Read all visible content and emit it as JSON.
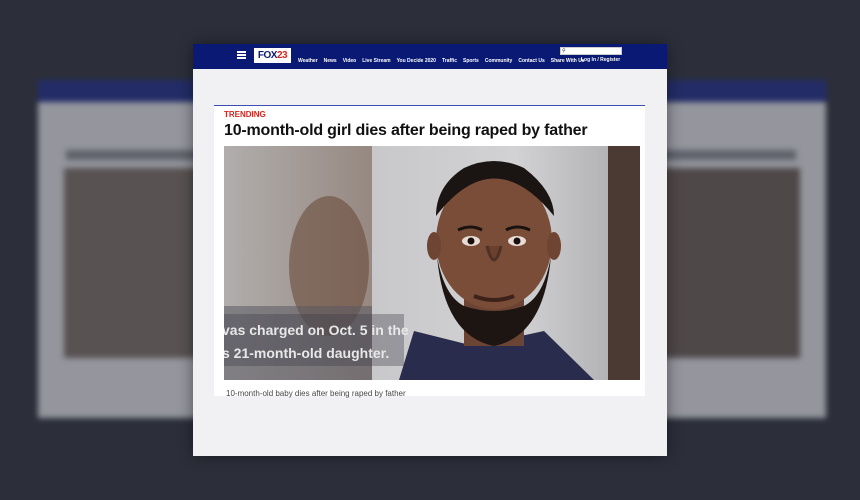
{
  "site": {
    "logo_text": "FOX",
    "logo_number": "23",
    "nav_items": [
      "Weather",
      "News",
      "Video",
      "Live Stream",
      "You Decide 2020",
      "Traffic",
      "Sports",
      "Community",
      "Contact Us",
      "Share With Us"
    ],
    "login_label": "Log In / Register"
  },
  "article": {
    "category": "TRENDING",
    "headline": "10-month-old girl dies after being raped by father",
    "video_overlay_line1": "vas charged on Oct. 5 in the",
    "video_overlay_line2": "s 21-month-old daughter.",
    "caption": "10-month-old baby dies after being raped by father"
  },
  "colors": {
    "nav_bg": "#0a1a74",
    "accent_red": "#d3261f",
    "page_bg": "#2c2f3a"
  },
  "icons": {
    "menu": "hamburger-icon",
    "search": "search-icon"
  }
}
